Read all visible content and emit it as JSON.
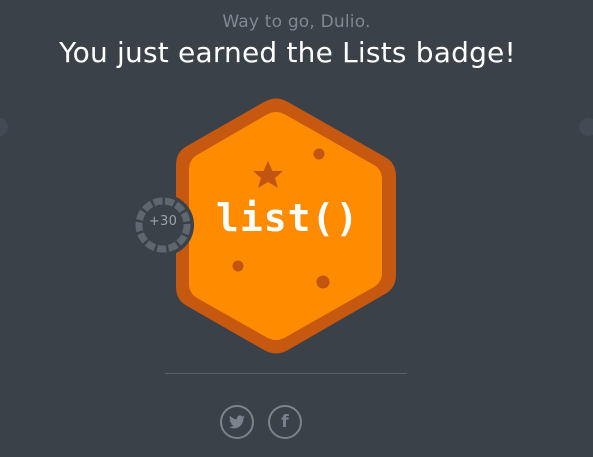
{
  "header": {
    "subtitle": "Way to go, Dulio.",
    "title": "You just earned the Lists badge!"
  },
  "badge": {
    "label": "list()",
    "colors": {
      "outer": "#c6580f",
      "inner": "#ff8c00",
      "decoration": "#c25510"
    }
  },
  "points": {
    "label": "+30",
    "ring_color": "#5e666f"
  },
  "share": {
    "twitter_icon": "twitter-icon",
    "facebook_icon": "facebook-icon",
    "facebook_glyph": "f"
  },
  "colors": {
    "background": "#3a4149",
    "subtitle": "#7f8893",
    "title": "#ffffff"
  }
}
